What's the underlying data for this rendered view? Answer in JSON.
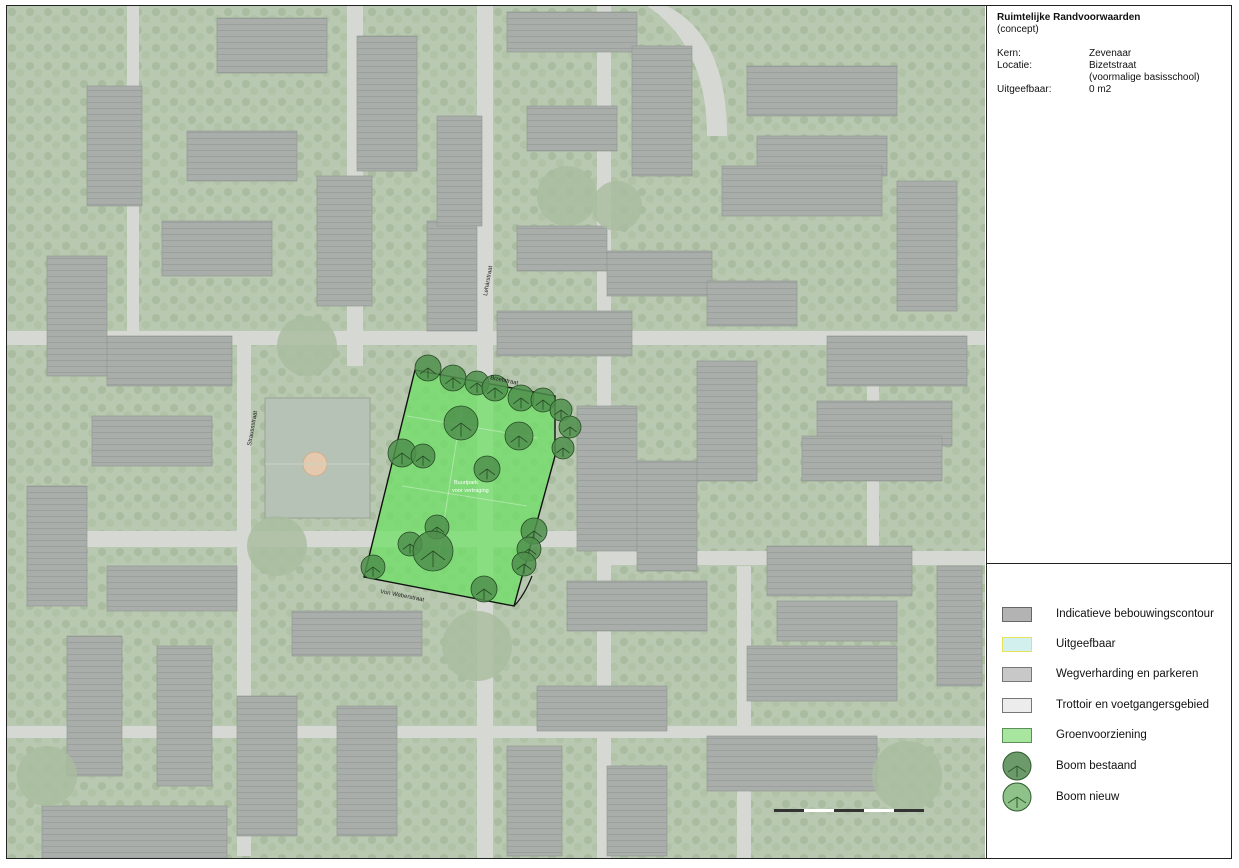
{
  "info": {
    "title": "Ruimtelijke Randvoorwaarden",
    "subtitle": "(concept)",
    "fields": [
      {
        "key": "Kern:",
        "value": "Zevenaar"
      },
      {
        "key": "Locatie:",
        "value": "Bizetstraat",
        "value2": "(voormalige basisschool)"
      },
      {
        "key": "Uitgeefbaar:",
        "value": "0 m2"
      }
    ]
  },
  "map": {
    "streets": {
      "north": "Bizetstraat",
      "east": "Lehárstraat",
      "west": "Straussstraat",
      "south": "Von Weberstraat"
    },
    "area_text_line1": "Buurtpark",
    "area_text_line2": "voor vertraging"
  },
  "legend": [
    {
      "label": "Indicatieve bebouwingscontour",
      "type": "swatch",
      "fill": "#b3b3b3",
      "border": "#666666"
    },
    {
      "label": "Uitgeefbaar",
      "type": "swatch",
      "fill": "#d2f0ee",
      "border": "#e8e35a"
    },
    {
      "label": "Wegverharding en parkeren",
      "type": "swatch",
      "fill": "#c8c8c8",
      "border": "#777777"
    },
    {
      "label": "Trottoir en voetgangersgebied",
      "type": "swatch",
      "fill": "#ececec",
      "border": "#777777"
    },
    {
      "label": "Groenvoorziening",
      "type": "swatch",
      "fill": "#a8e6a0",
      "border": "#5d8f5a"
    },
    {
      "label": "Boom bestaand",
      "type": "tree",
      "fill": "#6d9a6a"
    },
    {
      "label": "Boom nieuw",
      "type": "tree",
      "fill": "#8fc28a"
    }
  ],
  "colors": {
    "green_area": "#6be062",
    "tree_existing": "#4f8f4c",
    "tree_new": "#7ec57a"
  }
}
